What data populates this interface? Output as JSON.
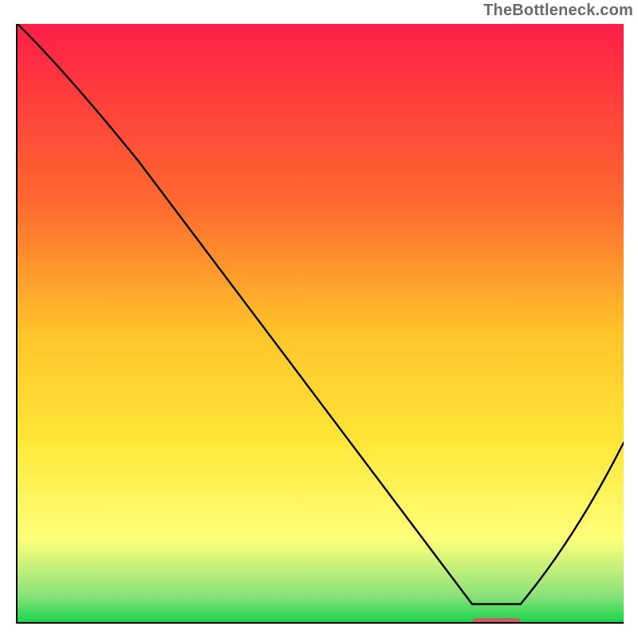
{
  "watermark": "TheBottleneck.com",
  "colors": {
    "red": "#ff1f47",
    "orange": "#ff9a2a",
    "yellow": "#ffe738",
    "paleyellow": "#ffff7a",
    "green_light": "#8be27a",
    "green": "#1ad64a",
    "curve": "#000000",
    "axis": "#000000",
    "marker": "#cd5d60"
  },
  "chart_data": {
    "type": "line",
    "title": "",
    "xlabel": "",
    "ylabel": "",
    "xlim": [
      0,
      100
    ],
    "ylim": [
      0,
      100
    ],
    "x": [
      0,
      20,
      75,
      83,
      100
    ],
    "values": [
      100,
      77,
      3,
      3,
      30
    ],
    "marker": {
      "x_start": 75,
      "x_end": 83,
      "y": 0
    },
    "gradient_stops": [
      {
        "pos": 0.0,
        "color": "#ff1f47"
      },
      {
        "pos": 0.3,
        "color": "#ff6a2f"
      },
      {
        "pos": 0.52,
        "color": "#ffc52a"
      },
      {
        "pos": 0.7,
        "color": "#ffe738"
      },
      {
        "pos": 0.86,
        "color": "#ffff7a"
      },
      {
        "pos": 0.955,
        "color": "#8be27a"
      },
      {
        "pos": 1.0,
        "color": "#1ad64a"
      }
    ]
  }
}
